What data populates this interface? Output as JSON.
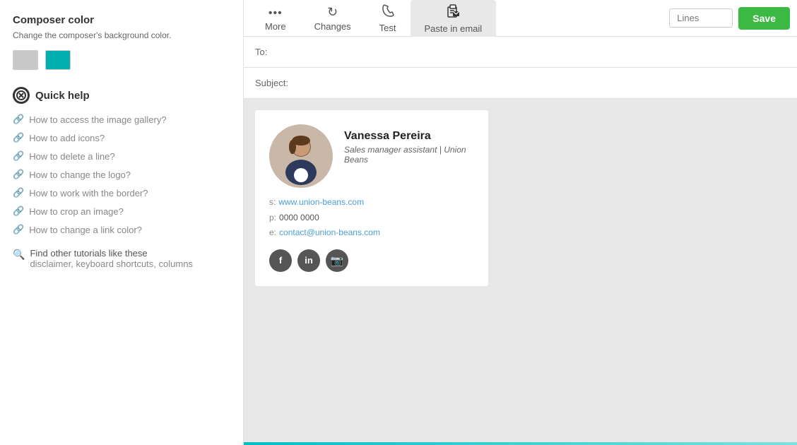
{
  "sidebar": {
    "composer_color": {
      "title": "Composer color",
      "description": "Change the composer's background color.",
      "swatch_gray_label": "gray swatch",
      "swatch_teal_label": "teal swatch"
    },
    "quick_help": {
      "title": "Quick help",
      "links": [
        "How to access the image gallery?",
        "How to add icons?",
        "How to delete a line?",
        "How to change the logo?",
        "How to work with the border?",
        "How to crop an image?",
        "How to change a link color?"
      ],
      "find_tutorials": {
        "prefix": "Find other tutorials like these",
        "links": "disclaimer, keyboard shortcuts, columns"
      }
    }
  },
  "topbar": {
    "tabs": [
      {
        "label": "More",
        "icon": "dots"
      },
      {
        "label": "Changes",
        "icon": "refresh"
      },
      {
        "label": "Test",
        "icon": "phone"
      },
      {
        "label": "Paste in email",
        "icon": "paste",
        "active": true
      }
    ],
    "lines_placeholder": "Lines",
    "save_label": "Save"
  },
  "compose": {
    "to_label": "To:",
    "subject_label": "Subject:",
    "signature": {
      "name": "Vanessa Pereira",
      "title": "Sales manager assistant | Union Beans",
      "website_label": "s:",
      "website_url": "www.union-beans.com",
      "phone_label": "p:",
      "phone": "0000 0000",
      "email_label": "e:",
      "email": "contact@union-beans.com",
      "social": [
        {
          "label": "f",
          "name": "facebook"
        },
        {
          "label": "in",
          "name": "linkedin"
        },
        {
          "label": "📷",
          "name": "instagram"
        }
      ]
    }
  }
}
